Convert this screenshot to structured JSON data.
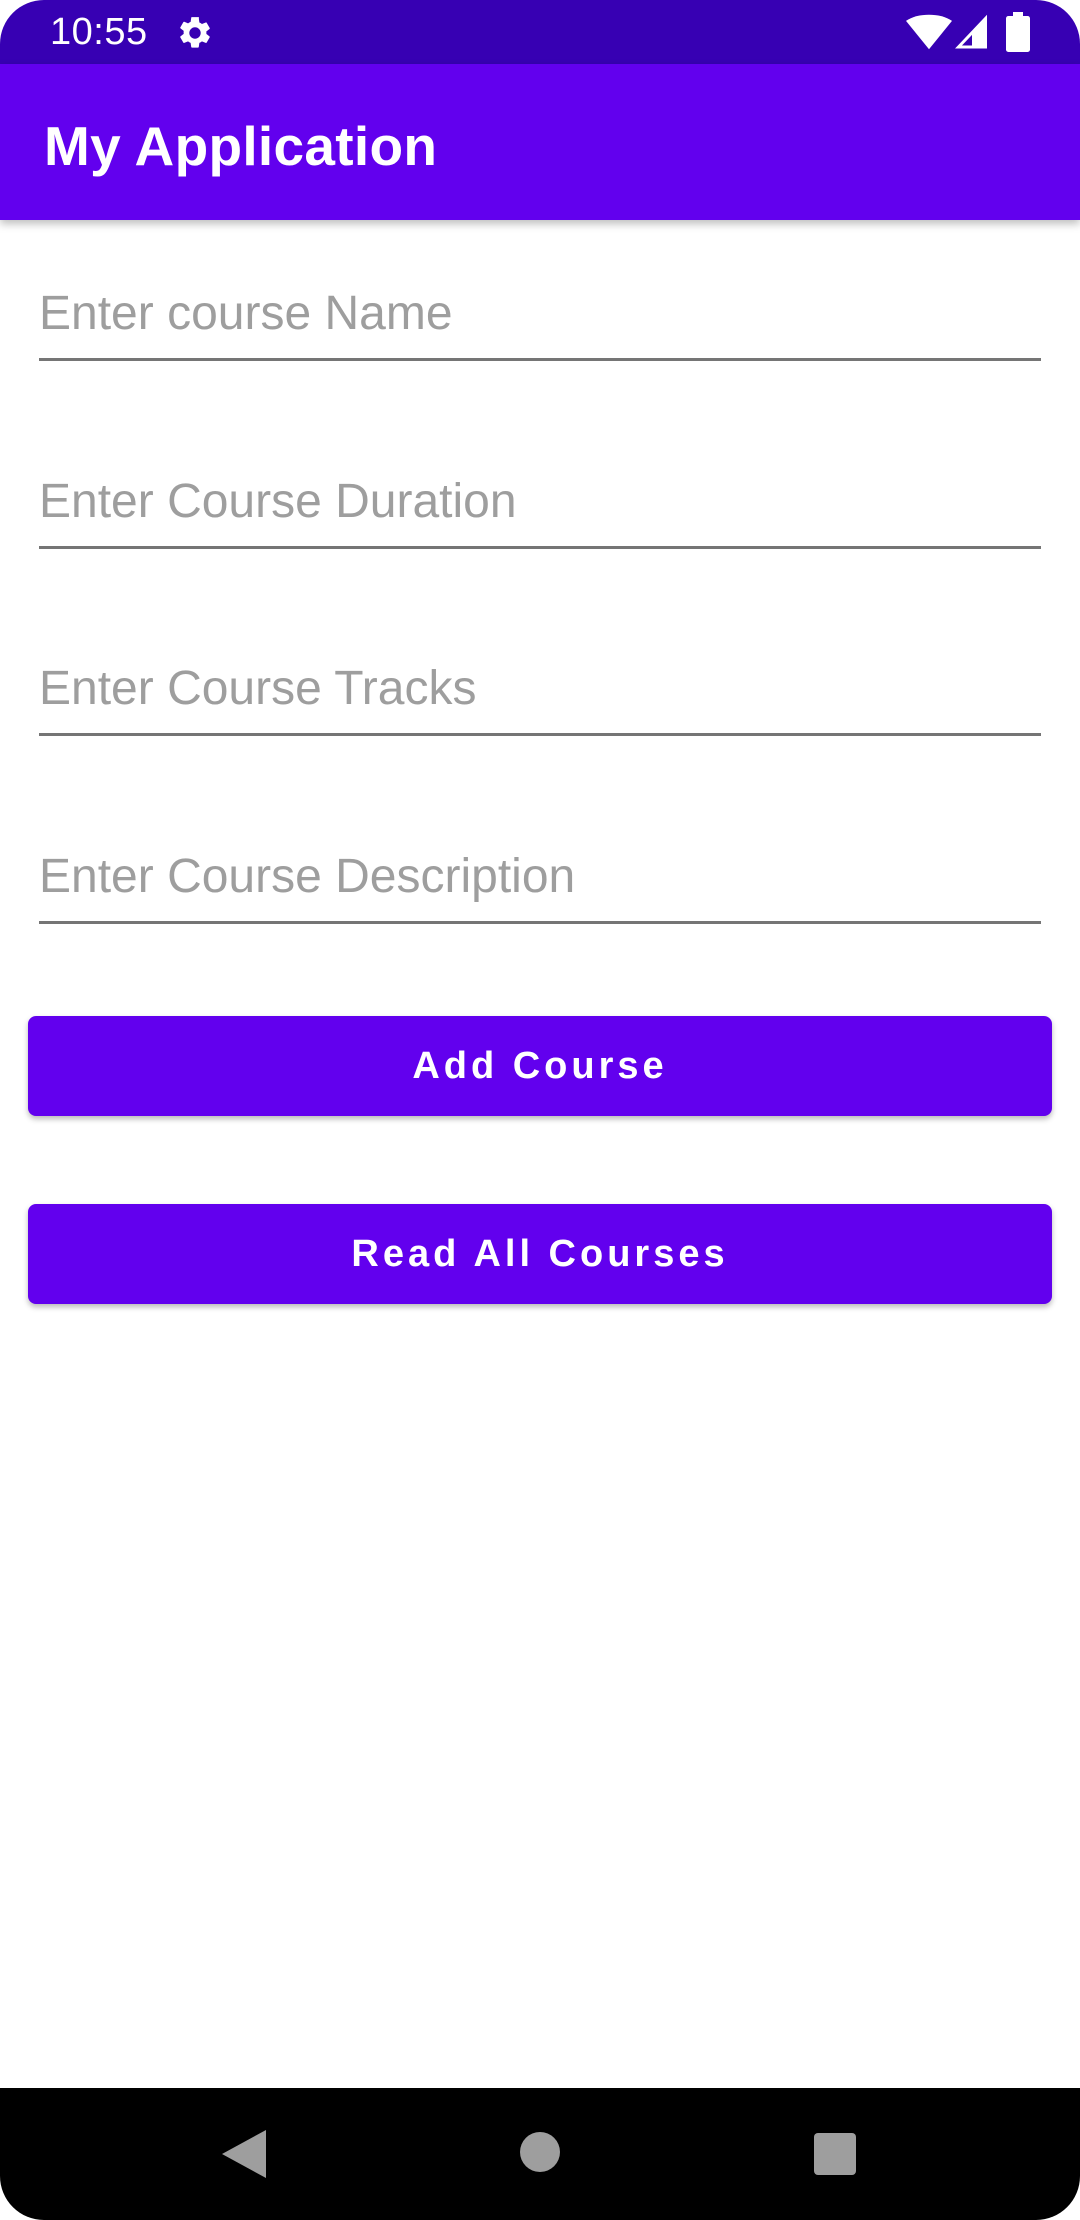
{
  "status_bar": {
    "time": "10:55",
    "icons": [
      "gear-icon",
      "wifi-icon",
      "signal-icon",
      "battery-icon"
    ]
  },
  "app_bar": {
    "title": "My Application"
  },
  "form": {
    "course_name_placeholder": "Enter course Name",
    "course_duration_placeholder": "Enter Course Duration",
    "course_tracks_placeholder": "Enter Course Tracks",
    "course_description_placeholder": "Enter Course Description"
  },
  "buttons": {
    "add_course": "Add Course",
    "read_all_courses": "Read All Courses"
  },
  "nav_bar": {
    "icons": [
      "back-icon",
      "home-icon",
      "recents-icon"
    ]
  },
  "colors": {
    "status_bar": "#3700b3",
    "primary": "#6200ee",
    "hint_text": "#9e9e9e",
    "underline": "#757575",
    "nav_bar": "#000000"
  }
}
